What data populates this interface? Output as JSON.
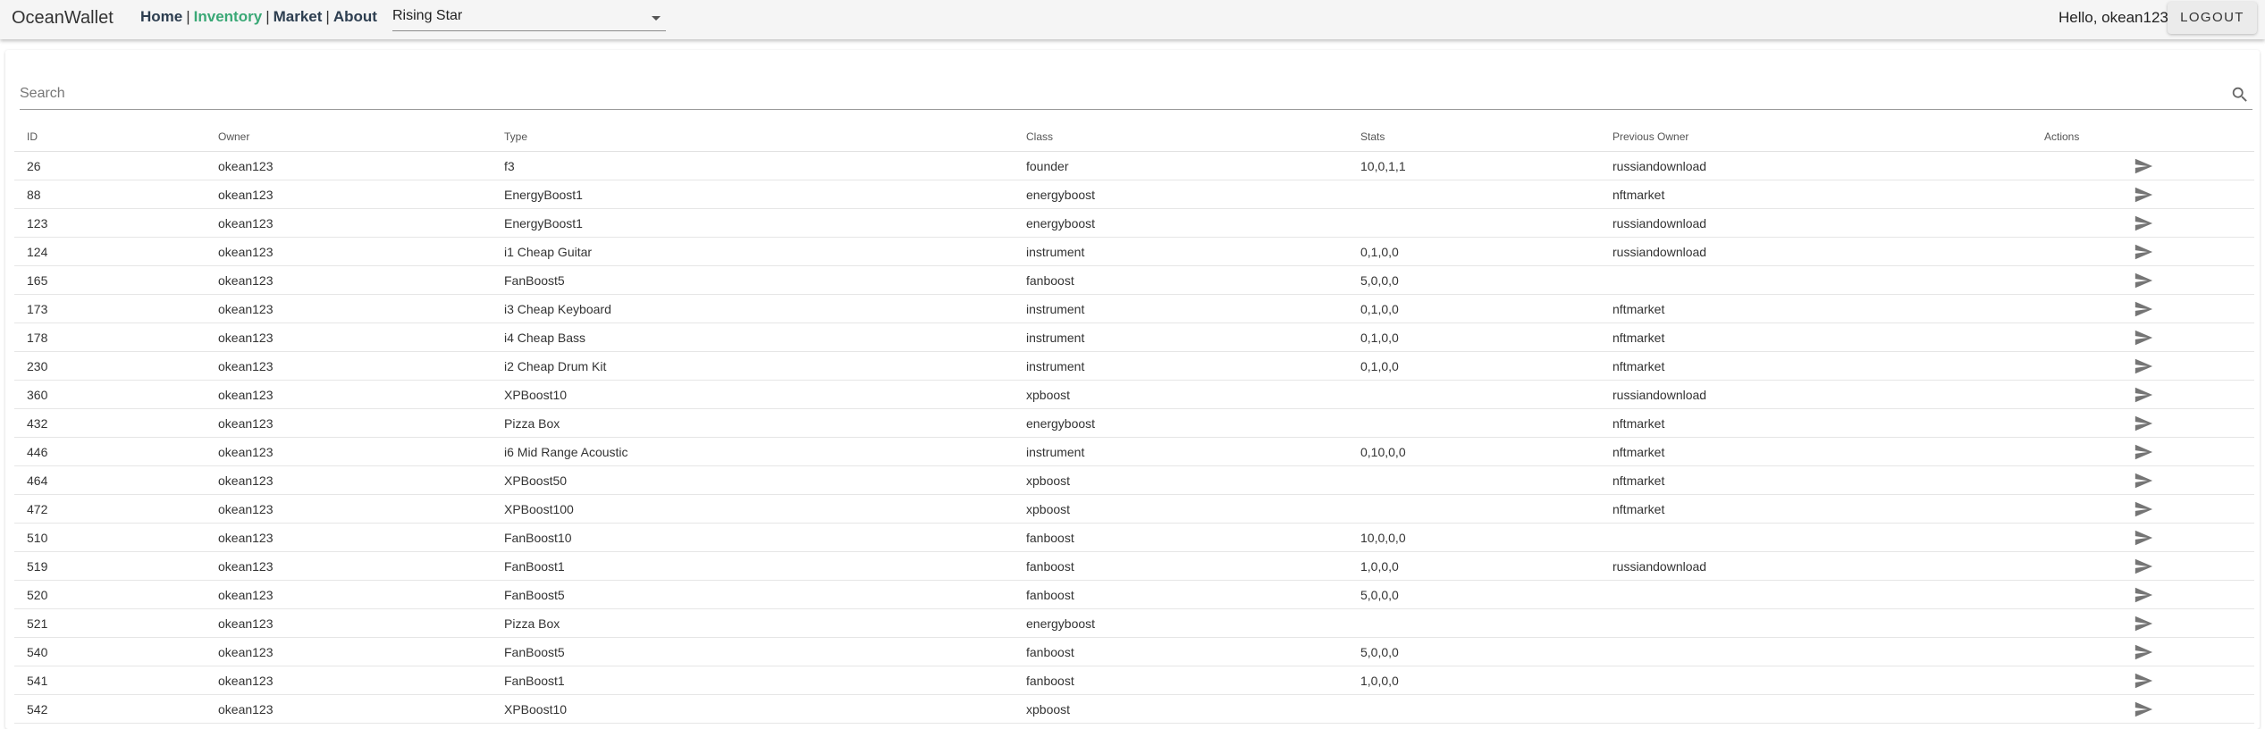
{
  "app": {
    "brand": "OceanWallet",
    "nav": [
      {
        "label": "Home",
        "active": false
      },
      {
        "label": "Inventory",
        "active": true
      },
      {
        "label": "Market",
        "active": false
      },
      {
        "label": "About",
        "active": false
      }
    ],
    "nav_separator": "|",
    "selected_collection": "Rising Star",
    "greeting": "Hello, okean123",
    "logout_label": "LOGOUT",
    "accent_color": "#3aa876"
  },
  "search": {
    "placeholder": "Search",
    "value": "",
    "icon": "search-icon"
  },
  "table": {
    "columns": [
      "ID",
      "Owner",
      "Type",
      "Class",
      "Stats",
      "Previous Owner",
      "Actions"
    ],
    "action_icon": "send-icon",
    "rows": [
      [
        "26",
        "okean123",
        "f3",
        "founder",
        "10,0,1,1",
        "russiandownload"
      ],
      [
        "88",
        "okean123",
        "EnergyBoost1",
        "energyboost",
        "",
        "nftmarket"
      ],
      [
        "123",
        "okean123",
        "EnergyBoost1",
        "energyboost",
        "",
        "russiandownload"
      ],
      [
        "124",
        "okean123",
        "i1 Cheap Guitar",
        "instrument",
        "0,1,0,0",
        "russiandownload"
      ],
      [
        "165",
        "okean123",
        "FanBoost5",
        "fanboost",
        "5,0,0,0",
        ""
      ],
      [
        "173",
        "okean123",
        "i3 Cheap Keyboard",
        "instrument",
        "0,1,0,0",
        "nftmarket"
      ],
      [
        "178",
        "okean123",
        "i4 Cheap Bass",
        "instrument",
        "0,1,0,0",
        "nftmarket"
      ],
      [
        "230",
        "okean123",
        "i2 Cheap Drum Kit",
        "instrument",
        "0,1,0,0",
        "nftmarket"
      ],
      [
        "360",
        "okean123",
        "XPBoost10",
        "xpboost",
        "",
        "russiandownload"
      ],
      [
        "432",
        "okean123",
        "Pizza Box",
        "energyboost",
        "",
        "nftmarket"
      ],
      [
        "446",
        "okean123",
        "i6 Mid Range Acoustic",
        "instrument",
        "0,10,0,0",
        "nftmarket"
      ],
      [
        "464",
        "okean123",
        "XPBoost50",
        "xpboost",
        "",
        "nftmarket"
      ],
      [
        "472",
        "okean123",
        "XPBoost100",
        "xpboost",
        "",
        "nftmarket"
      ],
      [
        "510",
        "okean123",
        "FanBoost10",
        "fanboost",
        "10,0,0,0",
        ""
      ],
      [
        "519",
        "okean123",
        "FanBoost1",
        "fanboost",
        "1,0,0,0",
        "russiandownload"
      ],
      [
        "520",
        "okean123",
        "FanBoost5",
        "fanboost",
        "5,0,0,0",
        ""
      ],
      [
        "521",
        "okean123",
        "Pizza Box",
        "energyboost",
        "",
        ""
      ],
      [
        "540",
        "okean123",
        "FanBoost5",
        "fanboost",
        "5,0,0,0",
        ""
      ],
      [
        "541",
        "okean123",
        "FanBoost1",
        "fanboost",
        "1,0,0,0",
        ""
      ],
      [
        "542",
        "okean123",
        "XPBoost10",
        "xpboost",
        "",
        ""
      ]
    ]
  }
}
